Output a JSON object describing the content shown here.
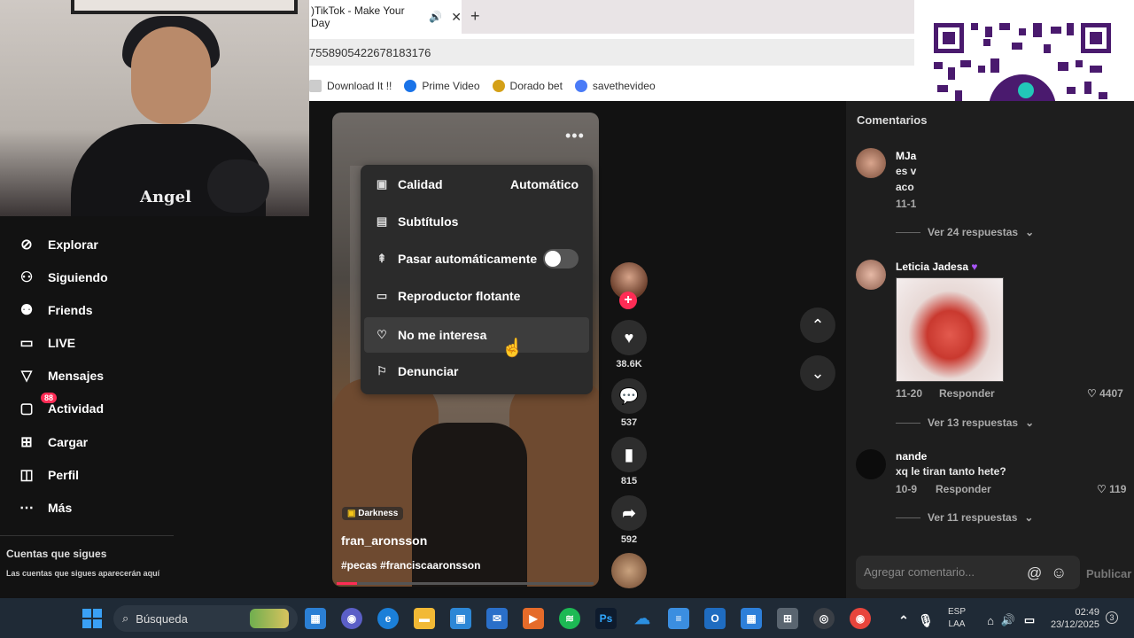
{
  "browser": {
    "tab_title": ")TikTok - Make Your Day",
    "new_tab_symbol": "+",
    "address": "7558905422678183176",
    "bookmarks": [
      "Download It !!",
      "Prime Video",
      "Dorado bet",
      "savethevideo"
    ]
  },
  "webcam": {
    "shirt_text": "Angel"
  },
  "sidebar": {
    "items": [
      {
        "label": "Explorar",
        "icon": "compass-icon"
      },
      {
        "label": "Siguiendo",
        "icon": "following-icon"
      },
      {
        "label": "Friends",
        "icon": "friends-icon"
      },
      {
        "label": "LIVE",
        "icon": "live-icon"
      },
      {
        "label": "Mensajes",
        "icon": "send-icon"
      },
      {
        "label": "Actividad",
        "icon": "activity-icon",
        "badge": "88"
      },
      {
        "label": "Cargar",
        "icon": "upload-icon"
      },
      {
        "label": "Perfil",
        "icon": "profile-icon"
      },
      {
        "label": "Más",
        "icon": "more-icon"
      }
    ],
    "following_title": "Cuentas que sigues",
    "following_note": "Las cuentas que sigues aparecerán aquí"
  },
  "video": {
    "music_tag": "Darkness",
    "author": "fran_aronsson",
    "hashtags": "#pecas #franciscaaronsson",
    "progress": 0.08
  },
  "menu": {
    "items": [
      {
        "label": "Calidad",
        "value": "Automático",
        "icon": "hd-icon"
      },
      {
        "label": "Subtítulos",
        "icon": "captions-icon"
      },
      {
        "label": "Pasar automáticamente",
        "icon": "autoscroll-icon",
        "toggle": false
      },
      {
        "label": "Reproductor flotante",
        "icon": "floating-player-icon"
      },
      {
        "label": "No me interesa",
        "icon": "heart-broken-icon",
        "highlighted": true
      },
      {
        "label": "Denunciar",
        "icon": "flag-icon"
      }
    ]
  },
  "actions": {
    "likes": "38.6K",
    "comments": "537",
    "saves": "815",
    "shares": "592"
  },
  "comments": {
    "title": "Comentarios",
    "items": [
      {
        "name": "MJa",
        "text_lines": [
          "es v",
          "aco"
        ],
        "date": "11-1",
        "more": "Ver 24 respuestas"
      },
      {
        "name": "Leticia Jadesa",
        "date": "11-20",
        "reply": "Responder",
        "likes": "4407",
        "more": "Ver 13 respuestas"
      },
      {
        "name": "nande",
        "text": "xq le tiran tanto hete?",
        "date": "10-9",
        "reply": "Responder",
        "likes": "119",
        "more": "Ver 11 respuestas"
      }
    ],
    "input_placeholder": "Agregar comentario...",
    "publish": "Publicar"
  },
  "taskbar": {
    "search": "Búsqueda",
    "lang_line1": "ESP",
    "lang_line2": "LAA",
    "time": "02:49",
    "date": "23/12/2025",
    "notifications": "3",
    "ps_label": "Ps"
  },
  "colors": {
    "accent": "#fe2c55",
    "qr": "#4a1a6e"
  }
}
